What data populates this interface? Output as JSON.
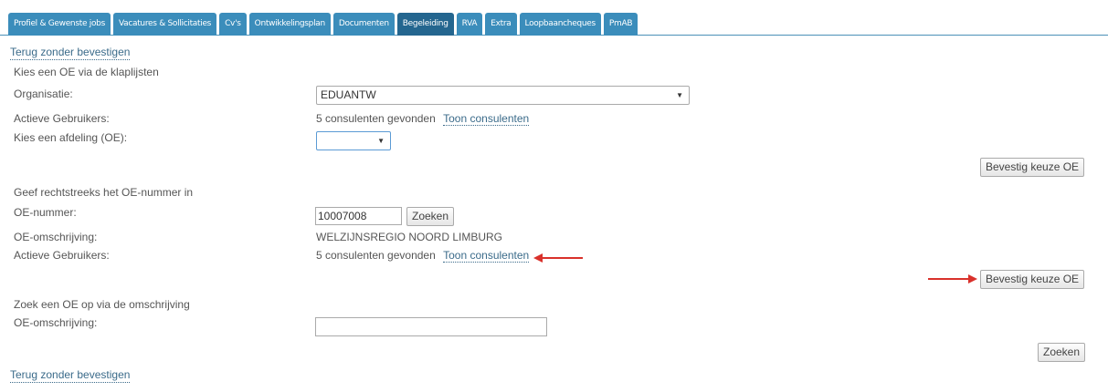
{
  "tabs": [
    {
      "label": "Profiel & Gewenste jobs"
    },
    {
      "label": "Vacatures & Sollicitaties"
    },
    {
      "label": "Cv's"
    },
    {
      "label": "Ontwikkelingsplan"
    },
    {
      "label": "Documenten"
    },
    {
      "label": "Begeleiding",
      "active": true
    },
    {
      "label": "RVA"
    },
    {
      "label": "Extra"
    },
    {
      "label": "Loopbaancheques"
    },
    {
      "label": "PmAB"
    }
  ],
  "back_link": "Terug zonder bevestigen",
  "section1": {
    "heading": "Kies een OE via de klaplijsten",
    "org_label": "Organisatie:",
    "org_value": "EDUANTW",
    "users_label": "Actieve Gebruikers:",
    "users_count": "5 consulenten gevonden",
    "show_link": "Toon consulenten",
    "dept_label": "Kies een afdeling (OE):",
    "dept_value": "",
    "confirm_button": "Bevestig keuze OE"
  },
  "section2": {
    "heading": "Geef rechtstreeks het OE-nummer in",
    "number_label": "OE-nummer:",
    "number_value": "10007008",
    "search_button": "Zoeken",
    "desc_label": "OE-omschrijving:",
    "desc_value": "WELZIJNSREGIO NOORD LIMBURG",
    "users_label": "Actieve Gebruikers:",
    "users_count": "5 consulenten gevonden",
    "show_link": "Toon consulenten",
    "confirm_button": "Bevestig keuze OE"
  },
  "section3": {
    "heading": "Zoek een OE op via de omschrijving",
    "desc_label": "OE-omschrijving:",
    "desc_value": "",
    "search_button": "Zoeken"
  },
  "colors": {
    "tab": "#3b8dbb",
    "tab_active": "#24668f",
    "annotation_arrow": "#d9312b"
  }
}
